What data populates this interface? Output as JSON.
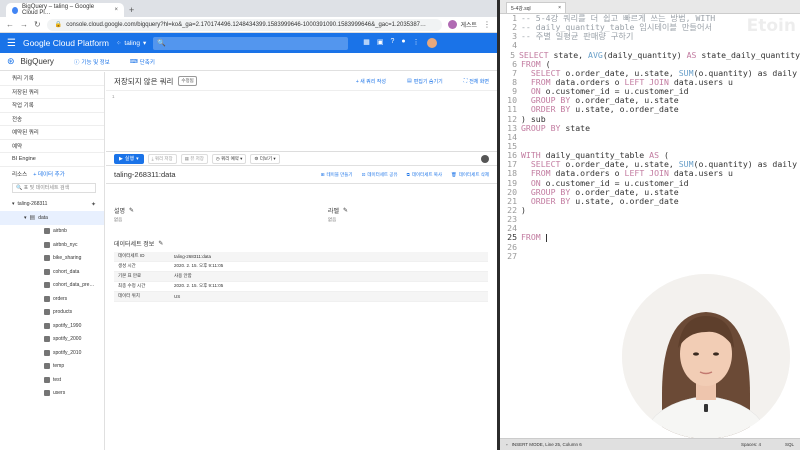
{
  "browser": {
    "tab_title": "BigQuery – taling – Google Cloud Pl…",
    "tab_close": "×",
    "new_tab": "+",
    "url": "console.cloud.google.com/bigquery?hl=ko&_ga=2.170174496.1248434399.1583999646-1000391090.1583999646&_gac=1.2035387…",
    "profile_label": "게스트"
  },
  "gcp": {
    "title": "Google Cloud Platform",
    "project": "taling"
  },
  "bigquery": {
    "title": "BigQuery",
    "features_link": "기능 및 정보",
    "shortcuts_link": "단축키"
  },
  "sidebar": {
    "items": [
      "쿼리 기록",
      "저장된 쿼리",
      "작업 기록",
      "전송",
      "예약된 쿼리",
      "예약",
      "BI Engine"
    ],
    "resources_label": "리소스",
    "add_data_label": "+ 데이터 추가",
    "table_search_placeholder": "표 및 데이터세트 검색",
    "project_node": "taling-268311",
    "dataset_node": "data",
    "tables": [
      "airbnb",
      "airbnb_nyc",
      "bike_sharing",
      "cohort_data",
      "cohort_data_pre…",
      "orders",
      "products",
      "spotify_1990",
      "spotify_2000",
      "spotify_2010",
      "temp",
      "test",
      "users"
    ]
  },
  "query": {
    "title": "저장되지 않은 쿼리",
    "badge": "수정됨",
    "new_query": "+ 새 쿼리 작성",
    "open_editor": "편집기 숨기기",
    "fullscreen": "전체 화면",
    "line1": "1"
  },
  "toolbar": {
    "run": "실행",
    "save_query": "쿼리 저장",
    "save_view": "뷰 저장",
    "schedule": "쿼리 예약",
    "more": "더보기"
  },
  "dataset": {
    "title": "taling-268311:data",
    "actions": [
      "테이블 만들기",
      "데이터세트 공유",
      "데이터세트 복사",
      "데이터세트 삭제"
    ],
    "description_label": "설명",
    "description_value": "없음",
    "labels_label": "라벨",
    "labels_value": "없음",
    "info_title": "데이터세트 정보",
    "info_rows": [
      {
        "key": "데이터세트 ID",
        "value": "taling-268311:data"
      },
      {
        "key": "생성 시간",
        "value": "2020. 2. 15. 오후 9:11:05"
      },
      {
        "key": "기본 표 만료",
        "value": "사용 안함"
      },
      {
        "key": "최종 수정 시간",
        "value": "2020. 2. 15. 오후 9:11:05"
      },
      {
        "key": "데이터 위치",
        "value": "US"
      }
    ]
  },
  "editor": {
    "filename": "5-4강.sql",
    "close": "×",
    "watermark": "Etoin",
    "lines": [
      {
        "n": "1",
        "parts": [
          {
            "c": "cm",
            "t": "-- 5-4강 쿼리를 더 쉽고 빠르게 쓰는 방법, WITH"
          }
        ]
      },
      {
        "n": "2",
        "parts": [
          {
            "c": "cm",
            "t": "-- daily_quantity_table 임시테이블 만들어서"
          }
        ]
      },
      {
        "n": "3",
        "parts": [
          {
            "c": "cm",
            "t": "-- 주별 일평균 판매량 구하기"
          }
        ]
      },
      {
        "n": "4",
        "parts": []
      },
      {
        "n": "5",
        "parts": [
          {
            "c": "kw",
            "t": "SELECT"
          },
          {
            "c": "",
            "t": " state, "
          },
          {
            "c": "fn",
            "t": "AVG"
          },
          {
            "c": "",
            "t": "(daily_quantity) "
          },
          {
            "c": "kw",
            "t": "AS"
          },
          {
            "c": "",
            "t": " state_daily_quantity"
          }
        ]
      },
      {
        "n": "6",
        "parts": [
          {
            "c": "kw",
            "t": "FROM"
          },
          {
            "c": "",
            "t": " ("
          }
        ]
      },
      {
        "n": "7",
        "parts": [
          {
            "c": "kw",
            "t": "  SELECT"
          },
          {
            "c": "",
            "t": " o.order_date, u.state, "
          },
          {
            "c": "fn",
            "t": "SUM"
          },
          {
            "c": "",
            "t": "(o.quantity) as daily"
          }
        ]
      },
      {
        "n": "8",
        "parts": [
          {
            "c": "kw",
            "t": "  FROM"
          },
          {
            "c": "",
            "t": " data.orders o "
          },
          {
            "c": "kw",
            "t": "LEFT JOIN"
          },
          {
            "c": "",
            "t": " data.users u"
          }
        ]
      },
      {
        "n": "9",
        "parts": [
          {
            "c": "kw",
            "t": "  ON"
          },
          {
            "c": "",
            "t": " o.customer_id = u.customer_id"
          }
        ]
      },
      {
        "n": "10",
        "parts": [
          {
            "c": "kw",
            "t": "  GROUP BY"
          },
          {
            "c": "",
            "t": " o.order_date, u.state"
          }
        ]
      },
      {
        "n": "11",
        "parts": [
          {
            "c": "kw",
            "t": "  ORDER BY"
          },
          {
            "c": "",
            "t": " u.state, o.order_date"
          }
        ]
      },
      {
        "n": "12",
        "parts": [
          {
            "c": "",
            "t": ") sub"
          }
        ]
      },
      {
        "n": "13",
        "parts": [
          {
            "c": "kw",
            "t": "GROUP BY"
          },
          {
            "c": "",
            "t": " state"
          }
        ]
      },
      {
        "n": "14",
        "parts": []
      },
      {
        "n": "15",
        "parts": []
      },
      {
        "n": "16",
        "parts": [
          {
            "c": "kw",
            "t": "WITH"
          },
          {
            "c": "",
            "t": " daily_quantity_table "
          },
          {
            "c": "kw",
            "t": "AS"
          },
          {
            "c": "",
            "t": " ("
          }
        ]
      },
      {
        "n": "17",
        "parts": [
          {
            "c": "kw",
            "t": "  SELECT"
          },
          {
            "c": "",
            "t": " o.order_date, u.state, "
          },
          {
            "c": "fn",
            "t": "SUM"
          },
          {
            "c": "",
            "t": "(o.quantity) as daily"
          }
        ]
      },
      {
        "n": "18",
        "parts": [
          {
            "c": "kw",
            "t": "  FROM"
          },
          {
            "c": "",
            "t": " data.orders o "
          },
          {
            "c": "kw",
            "t": "LEFT JOIN"
          },
          {
            "c": "",
            "t": " data.users u"
          }
        ]
      },
      {
        "n": "19",
        "parts": [
          {
            "c": "kw",
            "t": "  ON"
          },
          {
            "c": "",
            "t": " o.customer_id = u.customer_id"
          }
        ]
      },
      {
        "n": "20",
        "parts": [
          {
            "c": "kw",
            "t": "  GROUP BY"
          },
          {
            "c": "",
            "t": " o.order_date, u.state"
          }
        ]
      },
      {
        "n": "21",
        "parts": [
          {
            "c": "kw",
            "t": "  ORDER BY"
          },
          {
            "c": "",
            "t": " u.state, o.order_date"
          }
        ]
      },
      {
        "n": "22",
        "parts": [
          {
            "c": "",
            "t": ")"
          }
        ]
      },
      {
        "n": "23",
        "parts": []
      },
      {
        "n": "24",
        "parts": []
      },
      {
        "n": "25",
        "parts": [
          {
            "c": "kw",
            "t": "FROM"
          },
          {
            "c": "",
            "t": " "
          }
        ],
        "cursor": true
      },
      {
        "n": "26",
        "parts": []
      },
      {
        "n": "27",
        "parts": []
      }
    ],
    "status_left": "INSERT MODE, Line 25, Column 6",
    "status_spaces": "Spaces: 4",
    "status_lang": "SQL"
  },
  "colors": {
    "gcp_blue": "#1a73e8",
    "keyword": "#c27ba0",
    "comment": "#9aa1a8",
    "function": "#6aa0c9"
  }
}
